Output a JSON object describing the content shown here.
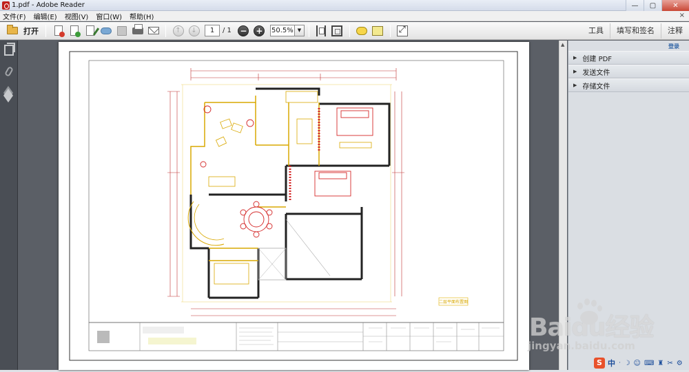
{
  "window": {
    "title": "1.pdf - Adobe Reader",
    "min_label": "—",
    "max_label": "▢",
    "close_label": "✕"
  },
  "menu": {
    "items": [
      "文件(F)",
      "编辑(E)",
      "视图(V)",
      "窗口(W)",
      "帮助(H)"
    ],
    "close": "×"
  },
  "toolbar": {
    "open_label": "打开",
    "page_current": "1",
    "page_total": "/ 1",
    "zoom": "50.5%",
    "zoom_arrow": "▼",
    "prev_glyph": "↑",
    "next_glyph": "↓",
    "zoom_out_glyph": "−",
    "zoom_in_glyph": "+",
    "right_buttons": [
      "工具",
      "填写和签名",
      "注释"
    ]
  },
  "right_panel": {
    "login": "登录",
    "items": [
      "创建 PDF",
      "发送文件",
      "存储文件"
    ],
    "tri": "▶"
  },
  "drawing": {
    "caption": "二层平面布置图"
  },
  "watermark": {
    "brand": "Baidu经验",
    "url": "jingyan.baidu.com"
  },
  "ime": {
    "logo": "S",
    "text": "中",
    "symbols": [
      "ᐧ",
      "☽",
      "☺",
      "⌨",
      "♜",
      "✂",
      "⚙"
    ]
  },
  "colors": {
    "accent": "#3568a8",
    "plan_walls": "#222222",
    "plan_lines": "#e0b000",
    "plan_dims": "#c03030",
    "plan_furniture": "#d42828"
  }
}
